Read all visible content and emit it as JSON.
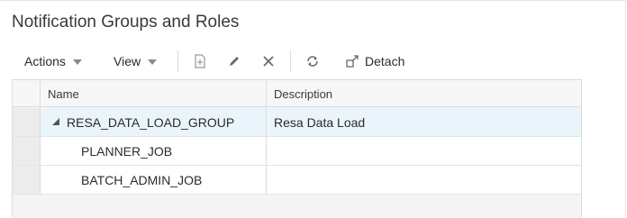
{
  "panel": {
    "title": "Notification Groups and Roles"
  },
  "toolbar": {
    "actions_label": "Actions",
    "view_label": "View",
    "detach_label": "Detach",
    "icons": [
      "add-icon",
      "edit-icon",
      "delete-icon",
      "refresh-icon",
      "detach-icon"
    ]
  },
  "table": {
    "columns": [
      "Name",
      "Description"
    ],
    "rows": [
      {
        "name": "RESA_DATA_LOAD_GROUP",
        "description": "Resa Data Load",
        "level": 0,
        "expanded": true,
        "selected": true
      },
      {
        "name": "PLANNER_JOB",
        "description": "",
        "level": 1,
        "selected": false
      },
      {
        "name": "BATCH_ADMIN_JOB",
        "description": "",
        "level": 1,
        "selected": false
      }
    ]
  },
  "colors": {
    "selected_row": "#eaf4fb",
    "header_bg": "#f7f7f7",
    "border": "#dcdcdc"
  }
}
